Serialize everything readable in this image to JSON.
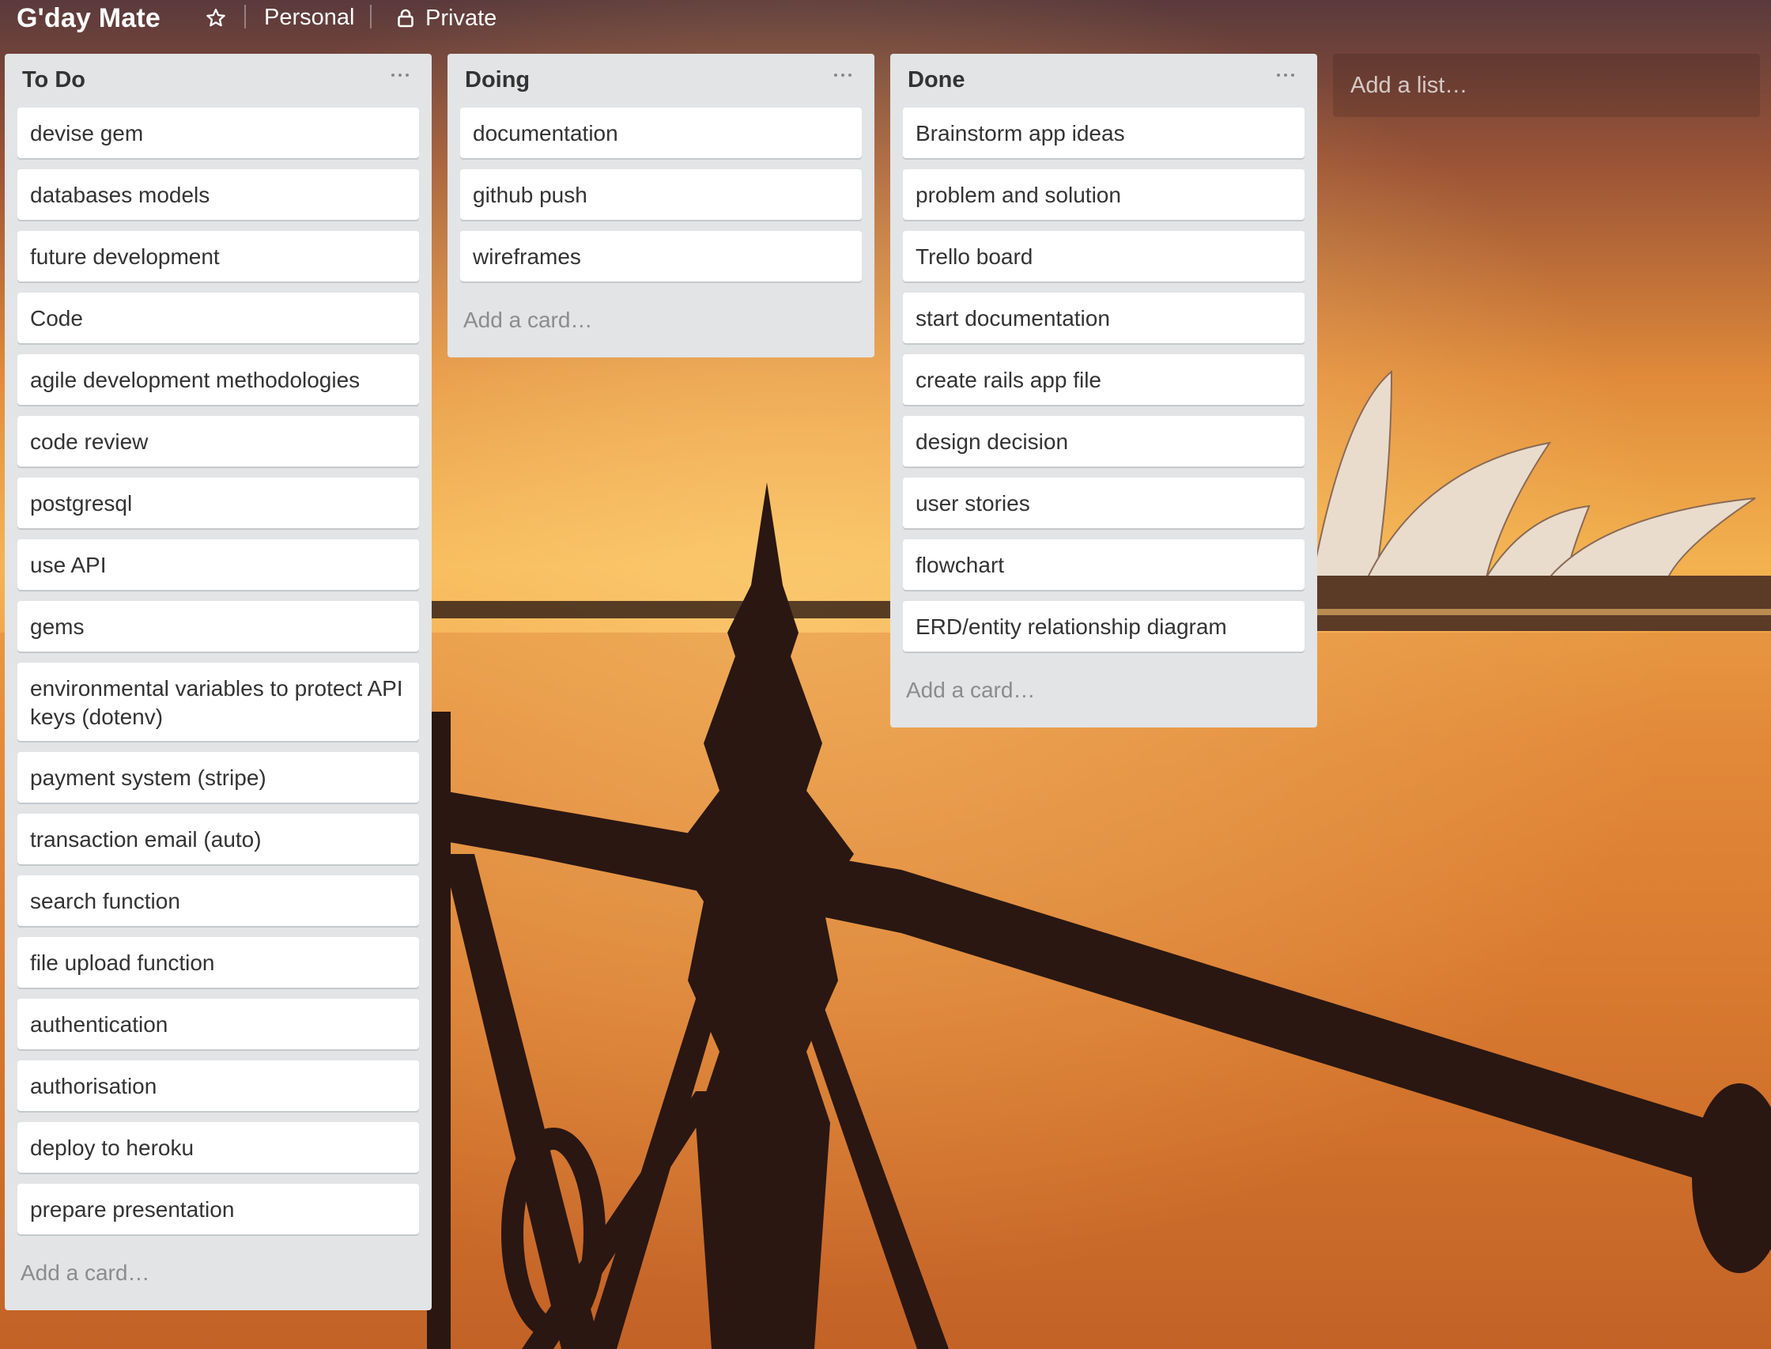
{
  "header": {
    "board_title": "G'day Mate",
    "star_icon": "star-outline-icon",
    "team_label": "Personal",
    "visibility_icon": "lock-icon",
    "visibility_label": "Private"
  },
  "lists": [
    {
      "title": "To Do",
      "cards": [
        "devise gem",
        "databases models",
        "future development",
        "Code",
        "agile development methodologies",
        "code review",
        "postgresql",
        "use API",
        "gems",
        "environmental variables to protect API keys (dotenv)",
        "payment system (stripe)",
        "transaction email (auto)",
        "search function",
        "file upload function",
        "authentication",
        "authorisation",
        "deploy to heroku",
        "prepare presentation"
      ],
      "add_card_label": "Add a card…"
    },
    {
      "title": "Doing",
      "cards": [
        "documentation",
        "github push",
        "wireframes"
      ],
      "add_card_label": "Add a card…"
    },
    {
      "title": "Done",
      "cards": [
        "Brainstorm app ideas",
        "problem and solution",
        "Trello board",
        "start documentation",
        "create rails app file",
        "design decision",
        "user stories",
        "flowchart",
        "ERD/entity relationship diagram"
      ],
      "add_card_label": "Add a card…"
    }
  ],
  "add_list_label": "Add a list…",
  "colors": {
    "list_background": "#e2e4e6",
    "card_background": "#ffffff",
    "text": "#333333",
    "muted_text": "#8c8c8c",
    "sunset_sky": "#e8893a",
    "sunset_water": "#d9782e"
  }
}
